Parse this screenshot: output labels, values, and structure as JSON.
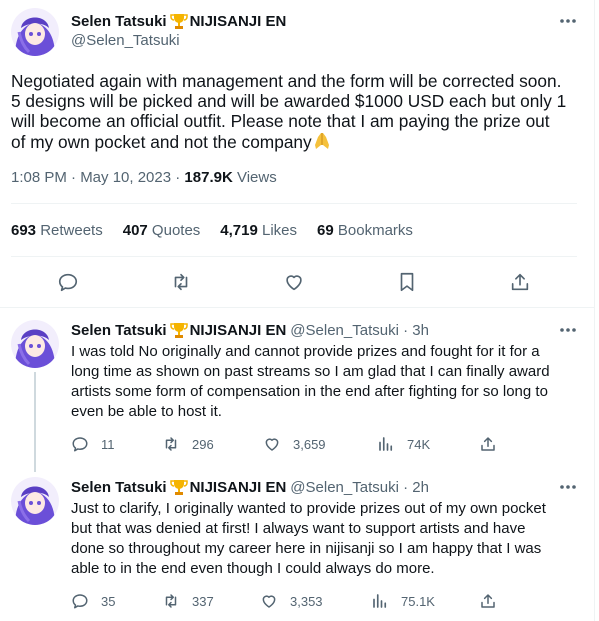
{
  "main_tweet": {
    "display_name": "Selen Tatsuki",
    "name_suffix": "NIJISANJI EN",
    "handle": "@Selen_Tatsuki",
    "text": "Negotiated again with management and the form will be corrected soon.\n5 designs will be picked and will be awarded $1000 USD each but only 1\nwill become an official outfit. Please note that I am paying the prize out\nof my own pocket and not the company",
    "time": "1:08 PM · May 10, 2023 · ",
    "views_count": "187.9K",
    "views_label": " Views",
    "stats": {
      "retweets_count": "693",
      "retweets_label": " Retweets",
      "quotes_count": "407",
      "quotes_label": " Quotes",
      "likes_count": "4,719",
      "likes_label": " Likes",
      "bookmarks_count": "69",
      "bookmarks_label": " Bookmarks"
    }
  },
  "replies": [
    {
      "display_name": "Selen Tatsuki",
      "name_suffix": "NIJISANJI EN",
      "handle_time": "@Selen_Tatsuki · 3h",
      "text": "I was told No originally and cannot provide prizes and fought for it for a\nlong time as shown on past streams so I am glad that I can finally award\nartists some form of compensation in the end after fighting for so long to\neven be able to host it.",
      "replies": "11",
      "retweets": "296",
      "likes": "3,659",
      "views": "74K"
    },
    {
      "display_name": "Selen Tatsuki",
      "name_suffix": "NIJISANJI EN",
      "handle_time": "@Selen_Tatsuki · 2h",
      "text": "Just to clarify, I originally wanted to provide prizes out of my own pocket\nbut that was denied at first! I always want to support artists and have\ndone so throughout my career here in nijisanji so I am happy that I was\nable to in the end even though I could always do more.",
      "replies": "35",
      "retweets": "337",
      "likes": "3,353",
      "views": "75.1K"
    }
  ],
  "icons": {
    "avatar": "avatar-image",
    "badge": "trophy-icon",
    "emoji": "folded-hands-icon",
    "more": "more-horizontal-icon",
    "reply": "reply-icon",
    "retweet": "retweet-icon",
    "like": "heart-icon",
    "bookmark": "bookmark-icon",
    "share": "share-icon",
    "views": "views-icon"
  },
  "colors": {
    "text": "#0f1419",
    "secondary": "#536471",
    "divider": "#eff3f4",
    "thread": "#cfd9de",
    "avatar_purple": "#6b4fd8"
  }
}
